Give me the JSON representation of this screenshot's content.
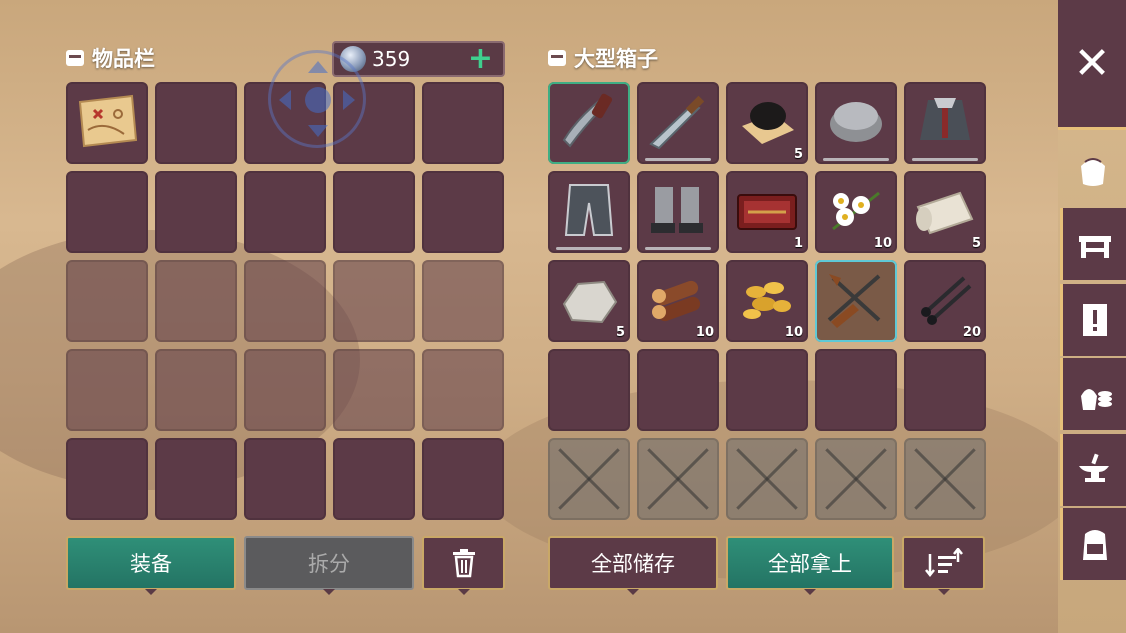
{
  "inventory": {
    "title": "物品栏",
    "currency": {
      "amount": "359",
      "add_label": "+"
    },
    "buttons": {
      "equip": "装备",
      "split": "拆分",
      "trash_icon": "trash-icon"
    }
  },
  "chest": {
    "title": "大型箱子",
    "buttons": {
      "store_all": "全部储存",
      "take_all": "全部拿上",
      "sort_icon": "sort-icon"
    },
    "items": [
      {
        "name": "machete-item",
        "qty": "",
        "durability": false
      },
      {
        "name": "sword-item",
        "qty": "",
        "durability": true
      },
      {
        "name": "fur-pelt-item",
        "qty": "5",
        "durability": false
      },
      {
        "name": "fur-hat-item",
        "qty": "",
        "durability": true
      },
      {
        "name": "fur-coat-item",
        "qty": "",
        "durability": true
      },
      {
        "name": "fur-pants-item",
        "qty": "",
        "durability": true
      },
      {
        "name": "fur-boots-item",
        "qty": "",
        "durability": true
      },
      {
        "name": "tool-case-item",
        "qty": "1",
        "durability": false
      },
      {
        "name": "chamomile-item",
        "qty": "10",
        "durability": false
      },
      {
        "name": "cloth-roll-item",
        "qty": "5",
        "durability": false
      },
      {
        "name": "stone-item",
        "qty": "5",
        "durability": false
      },
      {
        "name": "logs-item",
        "qty": "10",
        "durability": false
      },
      {
        "name": "gold-nuggets-item",
        "qty": "10",
        "durability": false
      },
      {
        "name": "rifle-item",
        "qty": "",
        "durability": false
      },
      {
        "name": "nails-item",
        "qty": "20",
        "durability": false
      }
    ]
  },
  "sidebar": {
    "close_label": "✕",
    "tabs": [
      "bag-icon",
      "workbench-icon",
      "quest-icon",
      "resources-icon",
      "anvil-icon",
      "backpack-icon"
    ]
  }
}
